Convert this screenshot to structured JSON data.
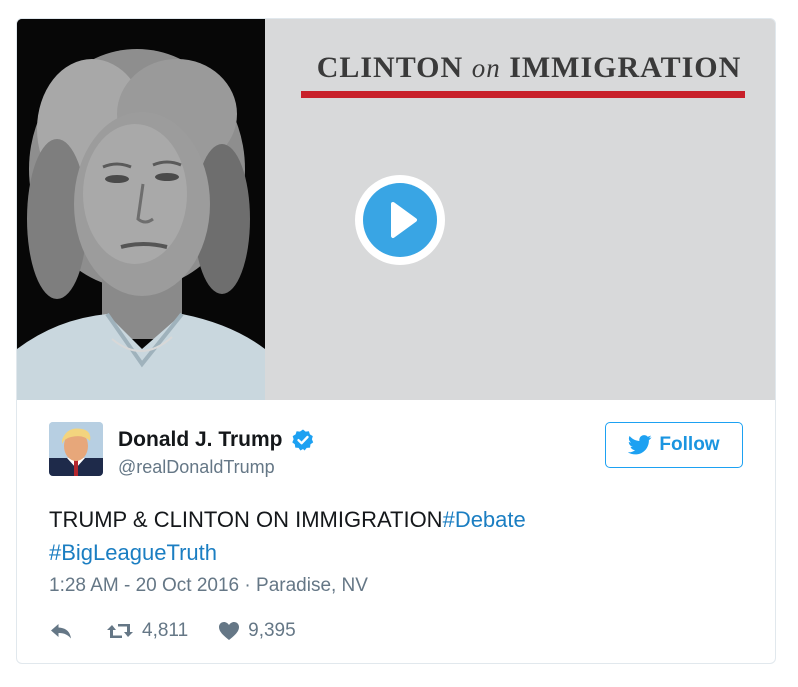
{
  "media": {
    "title_part1": "CLINTON",
    "title_on": "on",
    "title_part2": "IMMIGRATION",
    "play_icon": "play-icon",
    "accent_color": "#c8202a",
    "play_color": "#39a5e4"
  },
  "author": {
    "name": "Donald J. Trump",
    "handle": "@realDonaldTrump",
    "verified": true
  },
  "follow": {
    "label": "Follow",
    "icon": "twitter-bird-icon"
  },
  "tweet": {
    "text": "TRUMP & CLINTON ON IMMIGRATION",
    "hashtags": [
      "#Debate",
      "#BigLeagueTruth"
    ]
  },
  "meta": {
    "timestamp": "1:28 AM - 20 Oct 2016",
    "separator": "·",
    "location": "Paradise, NV"
  },
  "actions": {
    "reply_icon": "reply-icon",
    "retweet_icon": "retweet-icon",
    "retweets": "4,811",
    "like_icon": "heart-icon",
    "likes": "9,395"
  }
}
